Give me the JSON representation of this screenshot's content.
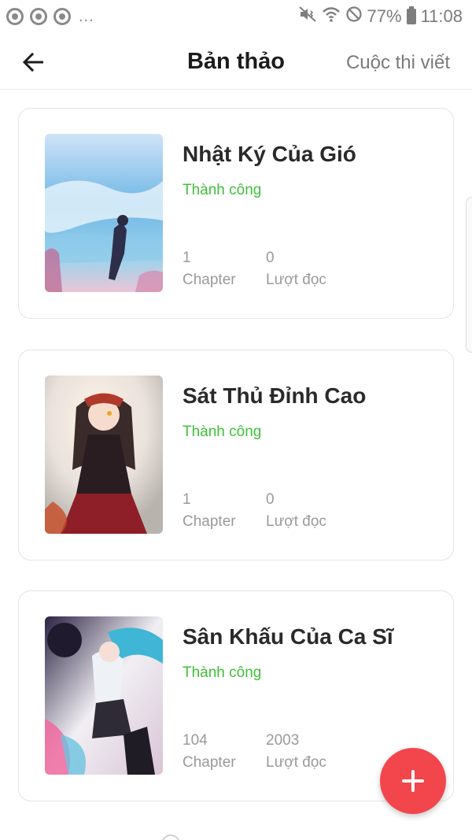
{
  "status_bar": {
    "notification_icons": [
      "chrome-icon",
      "chrome-icon",
      "chrome-icon"
    ],
    "more_indicator": "...",
    "signal_icons": [
      "mute-vibrate-icon",
      "wifi-icon",
      "do-not-disturb-icon"
    ],
    "battery": "77%",
    "time": "11:08"
  },
  "header": {
    "title": "Bản thảo",
    "action_label": "Cuộc thi viết"
  },
  "stories": [
    {
      "title": "Nhật Ký Của Gió",
      "status": "Thành công",
      "chapters": "1",
      "chapters_label": "Chapter",
      "reads": "0",
      "reads_label": "Lượt đọc"
    },
    {
      "title": "Sát Thủ Đỉnh Cao",
      "status": "Thành công",
      "chapters": "1",
      "chapters_label": "Chapter",
      "reads": "0",
      "reads_label": "Lượt đọc"
    },
    {
      "title": "Sân Khấu Của Ca Sĩ",
      "status": "Thành công",
      "chapters": "104",
      "chapters_label": "Chapter",
      "reads": "2003",
      "reads_label": "Lượt đọc"
    }
  ],
  "fab": {
    "icon": "plus-icon"
  },
  "colors": {
    "success": "#3fbf3a",
    "fab": "#f2464c",
    "muted_text": "#9a9a9a"
  }
}
